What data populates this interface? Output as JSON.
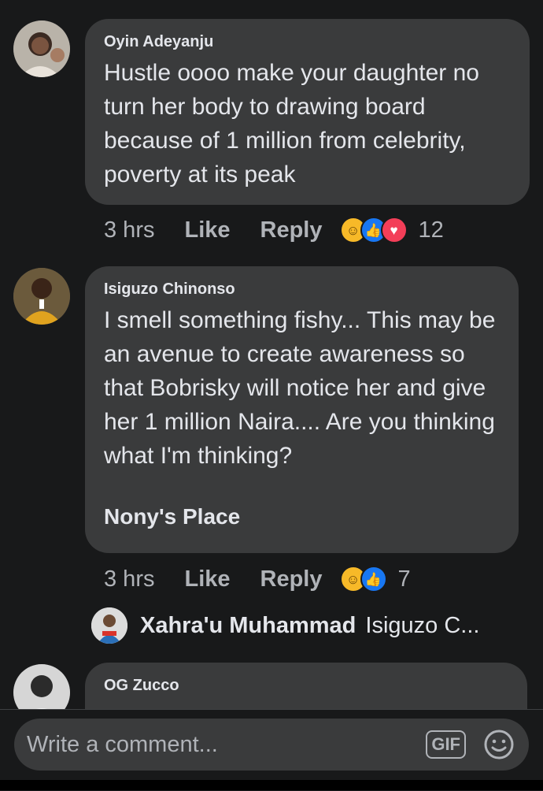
{
  "comments": [
    {
      "author": "Oyin Adeyanju",
      "text": "Hustle oooo make your daughter no turn her body to drawing board because of 1 million from celebrity, poverty at its peak",
      "time": "3 hrs",
      "like_label": "Like",
      "reply_label": "Reply",
      "reactions": [
        "haha",
        "like",
        "love"
      ],
      "reaction_count": "12"
    },
    {
      "author": "Isiguzo Chinonso",
      "text": "I smell something fishy... This may be an avenue to create awareness so that Bobrisky will notice her and give her 1 million Naira.... Are you thinking what I'm thinking?",
      "signature": "Nony's Place",
      "time": "3 hrs",
      "like_label": "Like",
      "reply_label": "Reply",
      "reactions": [
        "haha",
        "like"
      ],
      "reaction_count": "7",
      "reply_preview": {
        "author": "Xahra'u Muhammad",
        "snippet": "Isiguzo C..."
      }
    },
    {
      "author": "OG Zucco"
    }
  ],
  "composer": {
    "placeholder": "Write a comment...",
    "gif_label": "GIF",
    "emoji_icon": "smiley-icon"
  }
}
